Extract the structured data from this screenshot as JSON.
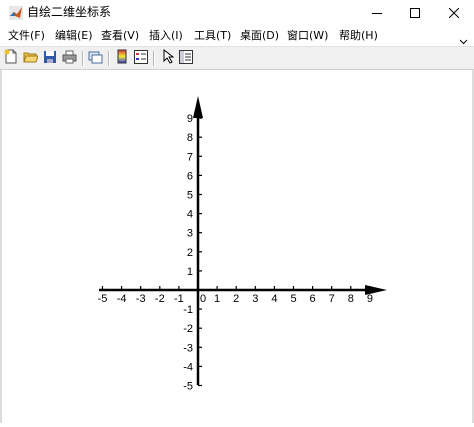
{
  "window": {
    "title": "自绘二维坐标系",
    "controls": {
      "minimize": "minimize",
      "maximize": "maximize",
      "close": "close"
    }
  },
  "menu": {
    "items": [
      {
        "label": "文件(F)"
      },
      {
        "label": "编辑(E)"
      },
      {
        "label": "查看(V)"
      },
      {
        "label": "插入(I)"
      },
      {
        "label": "工具(T)"
      },
      {
        "label": "桌面(D)"
      },
      {
        "label": "窗口(W)"
      },
      {
        "label": "帮助(H)"
      }
    ],
    "expand_icon": "chevron-down-icon"
  },
  "toolbar": {
    "buttons": [
      {
        "icon": "new-figure-icon"
      },
      {
        "icon": "open-file-icon"
      },
      {
        "icon": "save-icon"
      },
      {
        "icon": "print-icon"
      },
      {
        "icon": "link-plot-icon"
      },
      {
        "icon": "insert-colorbar-icon"
      },
      {
        "icon": "insert-legend-icon"
      },
      {
        "icon": "edit-plot-pointer-icon"
      },
      {
        "icon": "property-inspector-icon"
      }
    ]
  },
  "axes": {
    "x_ticks": [
      "-5",
      "-4",
      "-3",
      "-2",
      "-1",
      "0",
      "1",
      "2",
      "3",
      "4",
      "5",
      "6",
      "7",
      "8",
      "9"
    ],
    "y_ticks": [
      "9",
      "8",
      "7",
      "6",
      "5",
      "4",
      "3",
      "2",
      "1",
      "-1",
      "-2",
      "-3",
      "-4",
      "-5"
    ],
    "x_range": [
      -5,
      9
    ],
    "y_range": [
      -5,
      9
    ],
    "axis_color": "#000000"
  }
}
